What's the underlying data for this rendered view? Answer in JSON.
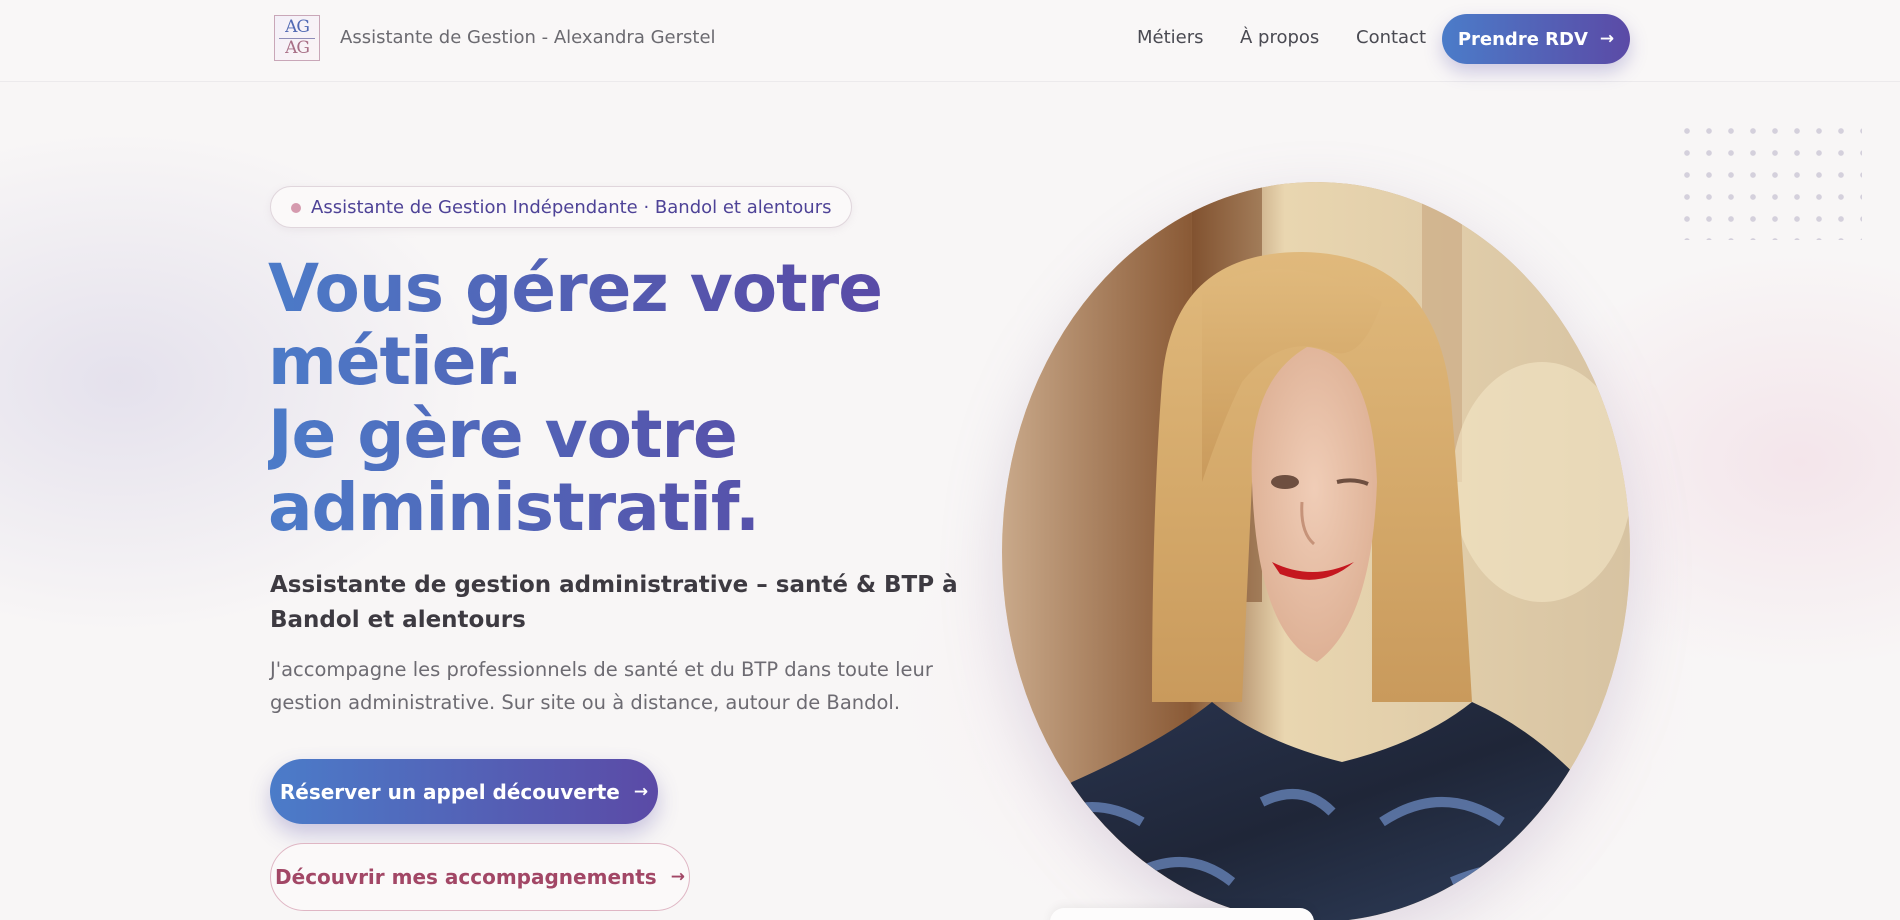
{
  "header": {
    "logo_top": "AG",
    "logo_bottom": "AG",
    "brand_name": "Assistante de Gestion - Alexandra Gerstel",
    "nav": {
      "metiers": "Métiers",
      "apropos": "À propos",
      "contact": "Contact"
    },
    "cta_label": "Prendre RDV"
  },
  "hero": {
    "badge": "Assistante de Gestion Indépendante · Bandol et alentours",
    "headline_lines": [
      "Vous gérez votre",
      "métier.",
      "Je gère votre",
      "administratif."
    ],
    "subtitle": "Assistante de gestion administrative – santé & BTP à Bandol et alentours",
    "description": "J'accompagne les professionnels de santé et du BTP dans toute leur gestion administrative. Sur site ou à distance, autour de Bandol.",
    "cta_primary": "Réserver un appel découverte",
    "cta_secondary": "Découvrir mes accompagnements"
  },
  "icons": {
    "arrow": "arrow-right-icon"
  },
  "colors": {
    "accent_start": "#4b7cc9",
    "accent_end": "#5b4aa6",
    "rose": "#a24766",
    "background": "#f8f6f6"
  }
}
